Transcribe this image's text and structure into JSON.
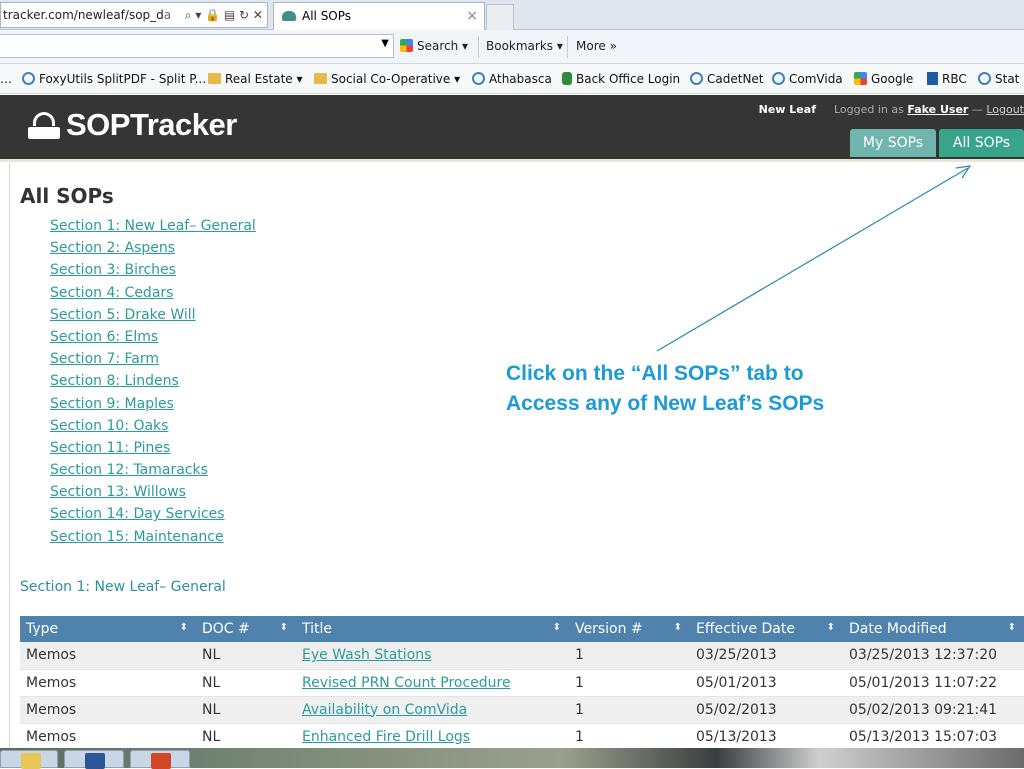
{
  "browser": {
    "address": "tracker.com/newleaf/sop_d",
    "address_tail": "a",
    "address_icons": "⌕ ▾ 🔒 ▤ ↻ ✕",
    "active_tab": "All SOPs",
    "tab_close": "×"
  },
  "command_bar": {
    "search_label": "Search",
    "bookmarks_label": "Bookmarks",
    "more_label": "More »"
  },
  "favorites": [
    {
      "label": "FoxyUtils SplitPDF - Split P...",
      "icon": "ie-icon"
    },
    {
      "label": "Real Estate ▾",
      "icon": "folder-icon"
    },
    {
      "label": "Social Co-Operative ▾",
      "icon": "folder-icon"
    },
    {
      "label": "Athabasca",
      "icon": "ie-icon"
    },
    {
      "label": "Back Office Login",
      "icon": "person-icon"
    },
    {
      "label": "CadetNet",
      "icon": "ie-icon"
    },
    {
      "label": "ComVida",
      "icon": "ie-icon"
    },
    {
      "label": "Google",
      "icon": "google-icon"
    },
    {
      "label": "RBC",
      "icon": "rbc-icon"
    },
    {
      "label": "Stat",
      "icon": "ie-icon"
    }
  ],
  "header": {
    "logo": "SOPTracker",
    "org": "New Leaf",
    "logged_in_as": "Logged in as",
    "user": "Fake User",
    "dash": " — ",
    "logout": "Logout",
    "tabs": {
      "my": "My SOPs",
      "all": "All SOPs"
    }
  },
  "page_title": "All SOPs",
  "sections": [
    "Section 1: New Leaf– General",
    "Section 2: Aspens",
    "Section 3: Birches",
    "Section 4: Cedars",
    "Section 5: Drake Will",
    "Section 6: Elms",
    "Section 7: Farm",
    "Section 8: Lindens",
    "Section 9: Maples",
    "Section 10: Oaks",
    "Section 11: Pines",
    "Section 12: Tamaracks",
    "Section 13: Willows",
    "Section 14: Day Services",
    "Section 15: Maintenance"
  ],
  "callout": {
    "line1": "Click on the “All SOPs” tab to",
    "line2": "Access any of New Leaf’s SOPs"
  },
  "section_heading": "Section 1: New Leaf– General",
  "table": {
    "headers": [
      "Type",
      "DOC #",
      "Title",
      "Version #",
      "Effective Date",
      "Date Modified"
    ],
    "sort_icon": "⬍",
    "rows": [
      {
        "type": "Memos",
        "doc": "NL",
        "title": "Eye Wash Stations",
        "version": "1",
        "effective": "03/25/2013",
        "modified": "03/25/2013 12:37:20"
      },
      {
        "type": "Memos",
        "doc": "NL",
        "title": "Revised PRN Count Procedure",
        "version": "1",
        "effective": "05/01/2013",
        "modified": "05/01/2013 11:07:22"
      },
      {
        "type": "Memos",
        "doc": "NL",
        "title": "Availability on ComVida",
        "version": "1",
        "effective": "05/02/2013",
        "modified": "05/02/2013 09:21:41"
      },
      {
        "type": "Memos",
        "doc": "NL",
        "title": "Enhanced Fire Drill Logs",
        "version": "1",
        "effective": "05/13/2013",
        "modified": "05/13/2013 15:07:03"
      }
    ]
  },
  "colors": {
    "header_bg": "#353535",
    "tab_active": "#39a48c",
    "tab_inactive": "#6fb5ab",
    "link": "#2c9b9b",
    "callout": "#1c9ad6",
    "table_header": "#4f83ae"
  }
}
